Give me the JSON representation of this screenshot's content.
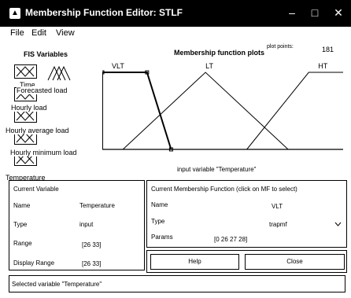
{
  "window": {
    "title": "Membership Function Editor: STLF",
    "controls": [
      "–",
      "□",
      "✕"
    ]
  },
  "menu": [
    "File",
    "Edit",
    "View"
  ],
  "fis_variables": {
    "label": "FIS Variables",
    "inputs": [
      "Time",
      "Forecasted load",
      "Hourly load",
      "Hourly average load",
      "Hourly minimum load",
      "Temperature"
    ],
    "selected": "Temperature"
  },
  "plot": {
    "title": "Membership function plots",
    "points_label": "plot points:",
    "points_value": "181",
    "xlabel": "input variable \"Temperature\""
  },
  "chart_data": {
    "type": "line",
    "xlabel": "input variable \"Temperature\"",
    "xlim": [
      26,
      33
    ],
    "ylim": [
      0,
      1
    ],
    "series": [
      {
        "name": "VLT",
        "x": [
          26,
          26,
          27.3,
          28
        ],
        "y": [
          0,
          1,
          1,
          0
        ]
      },
      {
        "name": "LT",
        "x": [
          26.6,
          29,
          31.4
        ],
        "y": [
          0,
          1,
          0
        ]
      },
      {
        "name": "HT",
        "x": [
          30.2,
          32,
          33
        ],
        "y": [
          0,
          1,
          1
        ]
      }
    ],
    "highlight": "VLT"
  },
  "current_variable": {
    "heading": "Current Variable",
    "name_label": "Name",
    "name_value": "Temperature",
    "type_label": "Type",
    "type_value": "input",
    "range_label": "Range",
    "range_value": "[26 33]",
    "display_range_label": "Display Range",
    "display_range_value": "[26 33]"
  },
  "current_mf": {
    "heading": "Current Membership Function (click on MF to select)",
    "name_label": "Name",
    "name_value": "VLT",
    "type_label": "Type",
    "type_value": "trapmf",
    "params_label": "Params",
    "params_value": "[0 26 27 28]"
  },
  "buttons": {
    "help": "Help",
    "close": "Close"
  },
  "status": "Selected variable \"Temperature\"",
  "colors": {
    "selected_mf": "#000000",
    "titlebar": "#000000"
  }
}
